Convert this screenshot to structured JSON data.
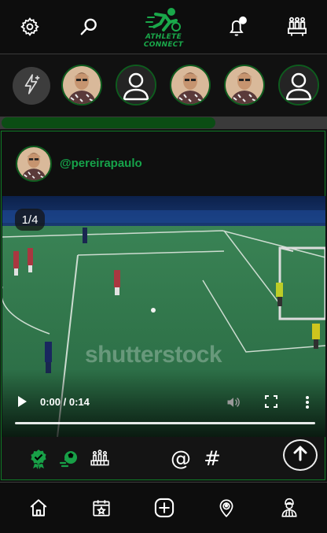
{
  "app": {
    "brand": "ATHLETE CONNECT",
    "brand_color": "#1aa84a"
  },
  "topbar": {
    "settings_icon": "gear-icon",
    "search_icon": "search-icon",
    "notifications_icon": "bell-soccer-icon",
    "teams_icon": "team-icon"
  },
  "stories": {
    "add_icon": "lightning-plus-icon",
    "items": [
      {
        "type": "photo"
      },
      {
        "type": "placeholder"
      },
      {
        "type": "photo"
      },
      {
        "type": "photo"
      },
      {
        "type": "placeholder"
      }
    ],
    "scroll_fraction": 0.66
  },
  "post": {
    "handle": "@pereirapaulo",
    "media_counter": "1/4",
    "video": {
      "time": "0:00 / 0:14",
      "watermark": "shutterstock",
      "progress": 0
    },
    "actions": {
      "at_label": "@",
      "hash_label": "#"
    }
  },
  "bottom_nav": {
    "items": [
      {
        "name": "home",
        "icon": "home-icon"
      },
      {
        "name": "calendar",
        "icon": "calendar-star-icon"
      },
      {
        "name": "create",
        "icon": "plus-square-icon"
      },
      {
        "name": "location",
        "icon": "location-soccer-icon"
      },
      {
        "name": "profile",
        "icon": "referee-icon"
      }
    ]
  }
}
